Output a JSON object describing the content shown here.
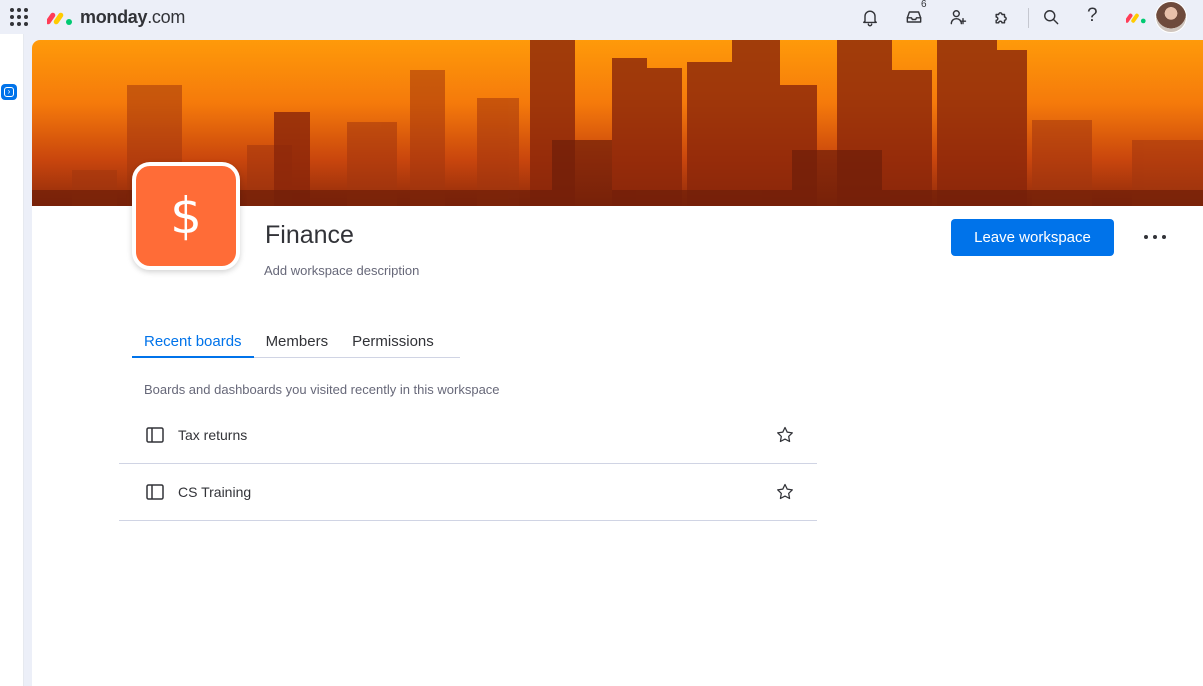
{
  "app": {
    "logo_brand": "monday",
    "logo_suffix": ".com",
    "inbox_count": "6",
    "help_symbol": "?"
  },
  "icons": {
    "apps": "grid-icon",
    "notifications": "bell-icon",
    "inbox": "inbox-icon",
    "invite": "add-user-icon",
    "integrations": "puzzle-icon",
    "search": "search-icon",
    "help": "help-icon",
    "board": "board-icon",
    "favorite": "star-icon"
  },
  "colors": {
    "accent": "#0073ea",
    "workspace_icon": "#ff6c37",
    "banner_top": "#ff9a0a",
    "banner_bottom": "#8e2a0c"
  },
  "workspace": {
    "icon_symbol": "$",
    "name": "Finance",
    "description_placeholder": "Add workspace description",
    "leave_label": "Leave workspace"
  },
  "tabs": [
    {
      "label": "Recent boards",
      "active": true
    },
    {
      "label": "Members",
      "active": false
    },
    {
      "label": "Permissions",
      "active": false
    }
  ],
  "recent": {
    "description": "Boards and dashboards you visited recently in this workspace",
    "boards": [
      {
        "name": "Tax returns"
      },
      {
        "name": "CS Training"
      }
    ]
  }
}
